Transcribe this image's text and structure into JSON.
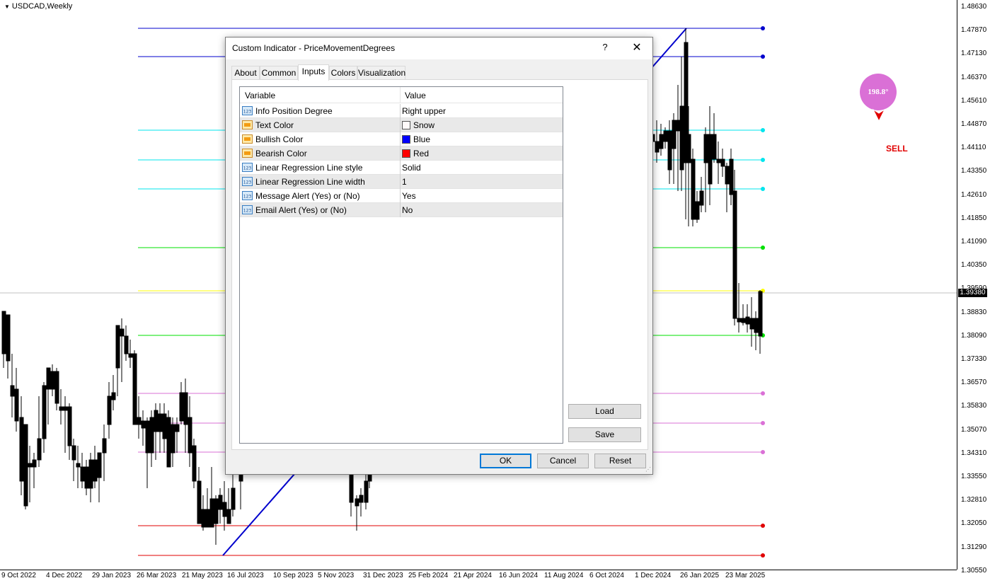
{
  "chart": {
    "symbol": "USDCAD,Weekly",
    "current_price": "1.39380",
    "price_ticks": [
      "1.48630",
      "1.47870",
      "1.47130",
      "1.46370",
      "1.45610",
      "1.44870",
      "1.44110",
      "1.43350",
      "1.42610",
      "1.41850",
      "1.41090",
      "1.40350",
      "1.39590",
      "1.38830",
      "1.38090",
      "1.37330",
      "1.36570",
      "1.35830",
      "1.35070",
      "1.34310",
      "1.33550",
      "1.32810",
      "1.32050",
      "1.31290",
      "1.30550"
    ],
    "time_ticks": [
      "9 Oct 2022",
      "4 Dec 2022",
      "29 Jan 2023",
      "26 Mar 2023",
      "21 May 2023",
      "16 Jul 2023",
      "10 Sep 2023",
      "5 Nov 2023",
      "31 Dec 2023",
      "25 Feb 2024",
      "21 Apr 2024",
      "16 Jun 2024",
      "11 Aug 2024",
      "6 Oct 2024",
      "1 Dec 2024",
      "26 Jan 2025",
      "23 Mar 2025"
    ],
    "degree_badge": "198.8°",
    "signal": "SELL",
    "colors": {
      "bullish": "#0000ff",
      "bearish": "#ff0000",
      "level_blue": "#0000cd",
      "level_cyan": "#00e5ee",
      "level_green": "#00e000",
      "level_yellow": "#ffff00",
      "level_violet": "#da70d6",
      "level_red": "#e00000",
      "badge": "#da70d6"
    }
  },
  "dialog": {
    "title": "Custom Indicator - PriceMovementDegrees",
    "help": "?",
    "close": "✕",
    "tabs": [
      "About",
      "Common",
      "Inputs",
      "Colors",
      "Visualization"
    ],
    "active_tab": "Inputs",
    "grid": {
      "col_variable": "Variable",
      "col_value": "Value",
      "rows": [
        {
          "icon": "numeric-input-icon",
          "variable": "Info Position Degree",
          "value": "Right upper"
        },
        {
          "icon": "color-input-icon",
          "variable": "Text Color",
          "value": "Snow",
          "swatch": "#fffafa"
        },
        {
          "icon": "color-input-icon",
          "variable": "Bullish Color",
          "value": "Blue",
          "swatch": "#0000ff"
        },
        {
          "icon": "color-input-icon",
          "variable": "Bearish Color",
          "value": "Red",
          "swatch": "#ff0000"
        },
        {
          "icon": "numeric-input-icon",
          "variable": "Linear Regression Line style",
          "value": "Solid"
        },
        {
          "icon": "numeric-input-icon",
          "variable": "Linear Regression Line width",
          "value": "1"
        },
        {
          "icon": "numeric-input-icon",
          "variable": "Message Alert (Yes) or (No)",
          "value": "Yes"
        },
        {
          "icon": "numeric-input-icon",
          "variable": "Email Alert (Yes) or (No)",
          "value": "No"
        }
      ]
    },
    "buttons": {
      "load": "Load",
      "save": "Save",
      "ok": "OK",
      "cancel": "Cancel",
      "reset": "Reset"
    }
  }
}
